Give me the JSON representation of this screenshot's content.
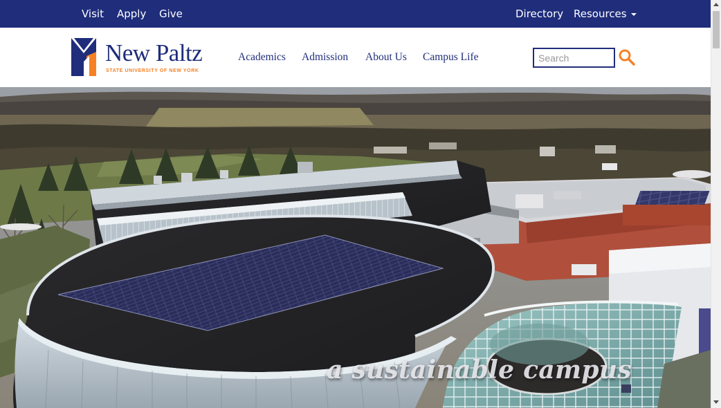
{
  "topbar": {
    "left_links": [
      "Visit",
      "Apply",
      "Give"
    ],
    "right_links": [
      "Directory",
      "Resources"
    ],
    "bg_color": "#1f2d7b"
  },
  "logo": {
    "name": "New Paltz",
    "tagline": "STATE UNIVERSITY OF NEW YORK",
    "brand_blue": "#1f2d7b",
    "brand_orange": "#f58025"
  },
  "nav": {
    "items": [
      "Academics",
      "Admission",
      "About Us",
      "Campus Life"
    ]
  },
  "search": {
    "placeholder": "Search",
    "icon": "search-icon"
  },
  "hero": {
    "caption": "a sustainable campus"
  }
}
